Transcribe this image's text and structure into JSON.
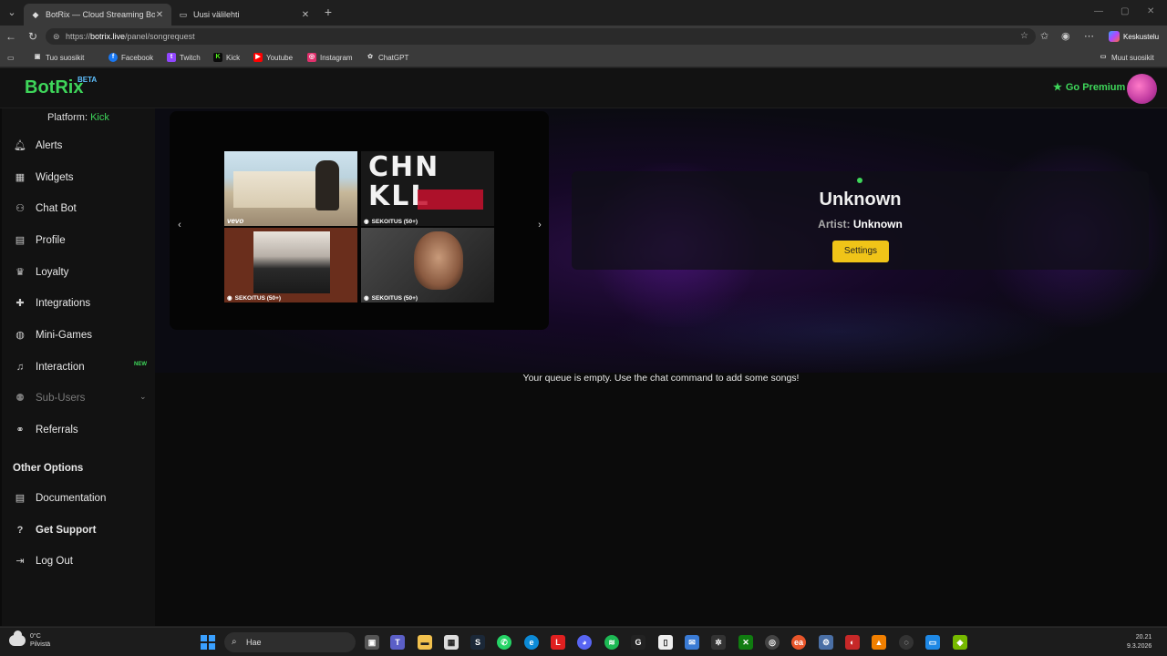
{
  "browser": {
    "tabs": [
      {
        "title": "BotRix — Cloud Streaming Bot for",
        "active": true
      },
      {
        "title": "Uusi välilehti",
        "active": false
      }
    ],
    "url": {
      "prefix": "https://",
      "host": "botrix.live",
      "path": "/panel/songrequest"
    },
    "chat_label": "Keskustelu",
    "bookmarks": [
      {
        "label": "Tuo suosikit",
        "icon": "import-icon"
      },
      {
        "label": "Facebook",
        "icon": "facebook-icon",
        "color": "#1877f2"
      },
      {
        "label": "Twitch",
        "icon": "twitch-icon",
        "color": "#9146ff"
      },
      {
        "label": "Kick",
        "icon": "kick-icon",
        "color": "#53fc18"
      },
      {
        "label": "Youtube",
        "icon": "youtube-icon",
        "color": "#ff0000"
      },
      {
        "label": "Instagram",
        "icon": "instagram-icon",
        "color": "#e1306c"
      },
      {
        "label": "ChatGPT",
        "icon": "chatgpt-icon",
        "color": "#cccccc"
      }
    ],
    "other_bookmarks": "Muut suosikit"
  },
  "app": {
    "logo": "BotRix",
    "beta": "BETA",
    "premium_label": "Go Premium",
    "accent": "#3ed65a"
  },
  "sidebar": {
    "platform_label": "Platform:",
    "platform_value": "Kick",
    "items": [
      {
        "label": "Alerts",
        "icon": "bell-icon"
      },
      {
        "label": "Widgets",
        "icon": "grid-icon"
      },
      {
        "label": "Chat Bot",
        "icon": "robot-icon"
      },
      {
        "label": "Profile",
        "icon": "profile-card-icon"
      },
      {
        "label": "Loyalty",
        "icon": "trophy-icon"
      },
      {
        "label": "Integrations",
        "icon": "puzzle-icon"
      },
      {
        "label": "Mini-Games",
        "icon": "gamepad-icon"
      },
      {
        "label": "Interaction",
        "icon": "music-note-icon",
        "badge": "NEW"
      },
      {
        "label": "Sub-Users",
        "icon": "users-icon",
        "disabled": true
      },
      {
        "label": "Referrals",
        "icon": "referral-icon"
      }
    ],
    "other_options_title": "Other Options",
    "other_items": [
      {
        "label": "Documentation",
        "icon": "document-icon"
      },
      {
        "label": "Get Support",
        "icon": "question-icon"
      },
      {
        "label": "Log Out",
        "icon": "logout-icon"
      }
    ]
  },
  "carousel": {
    "thumbs": [
      {
        "caption": "vevo",
        "kind": "vevo"
      },
      {
        "caption": "SEKOITUS (50+)",
        "kind": "mix"
      },
      {
        "caption": "SEKOITUS (50+)",
        "kind": "mix"
      },
      {
        "caption": "SEKOITUS (50+)",
        "kind": "mix"
      }
    ],
    "thumb2_text": "CHN KLL"
  },
  "now_playing": {
    "title": "Unknown",
    "artist_label": "Artist:",
    "artist": "Unknown",
    "settings_label": "Settings"
  },
  "queue": {
    "empty_message": "Your queue is empty. Use the chat command to add some songs!"
  },
  "taskbar": {
    "weather_temp": "0°C",
    "weather_desc": "Pilvistä",
    "search_placeholder": "Hae",
    "time": "20.21",
    "date": "9.3.2026"
  }
}
